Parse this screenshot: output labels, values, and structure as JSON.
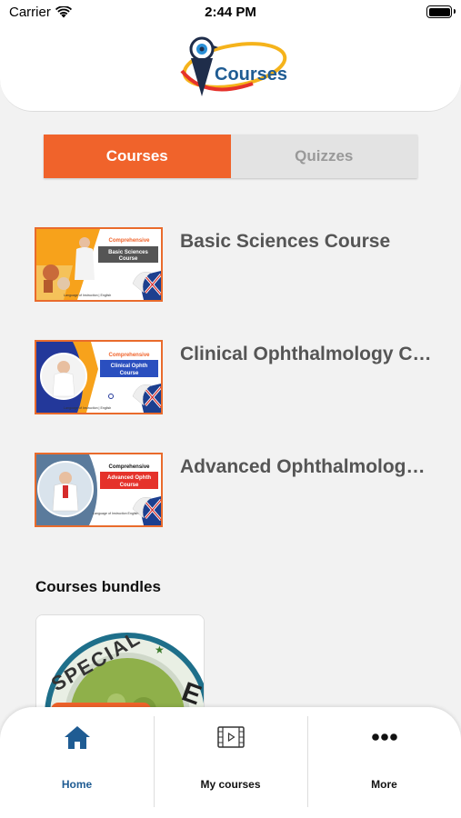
{
  "status_bar": {
    "carrier": "Carrier",
    "time": "2:44 PM"
  },
  "header": {
    "logo_text": "Courses"
  },
  "segments": {
    "active": "Courses",
    "inactive": "Quizzes"
  },
  "courses": [
    {
      "title": "Basic Sciences Course",
      "thumb_heading": "Comprehensive",
      "thumb_course": "Basic Sciences Course",
      "thumb_footer": "Language of Instruction | English"
    },
    {
      "title": "Clinical Ophthalmology Course",
      "thumb_heading": "Comprehensive",
      "thumb_course": "Clinical Ophth Course",
      "thumb_footer": "Language of Instruction | English"
    },
    {
      "title": "Advanced Ophthalmology Course",
      "thumb_heading": "Comprehensive",
      "thumb_course": "Advanced Ophth Course",
      "thumb_footer": "Language of Instruction English"
    }
  ],
  "bundles": {
    "title": "Courses bundles",
    "badge_text": "SPECIAL"
  },
  "tabbar": [
    {
      "label": "Home",
      "icon": "home-icon",
      "active": true
    },
    {
      "label": "My courses",
      "icon": "film-icon",
      "active": false
    },
    {
      "label": "More",
      "icon": "more-icon",
      "active": false
    }
  ],
  "colors": {
    "accent": "#f0632b",
    "tab_active": "#1f5c93",
    "segment_inactive": "#e3e3e3"
  }
}
